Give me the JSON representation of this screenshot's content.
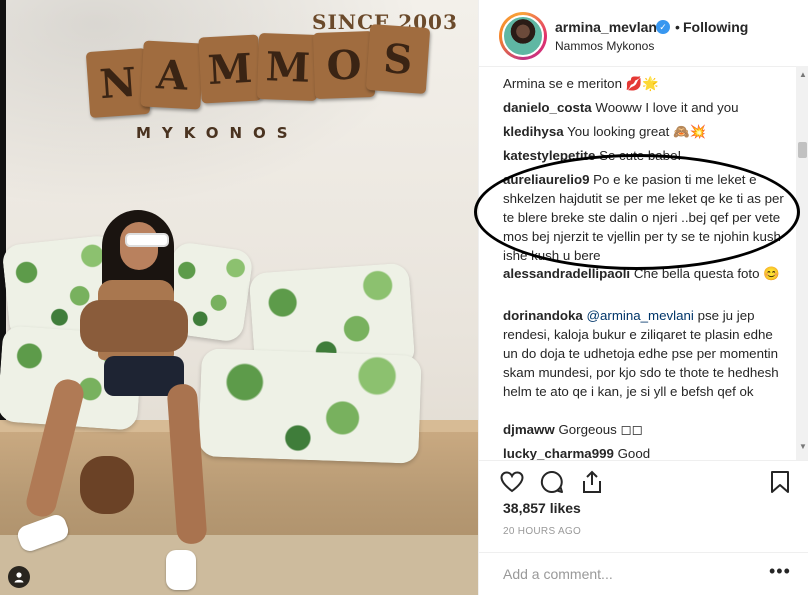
{
  "photo": {
    "sign_since": "SINCE 2003",
    "sign_letters": [
      "N",
      "A",
      "M",
      "M",
      "O",
      "S"
    ],
    "sign_sub": "MYKONOS",
    "tag_icon": "person-tag-icon"
  },
  "header": {
    "username": "armina_mevlani",
    "verified_icon": "verified-badge-icon",
    "separator": "•",
    "following_label": "Following",
    "location": "Nammos Mykonos"
  },
  "comments": [
    {
      "user": "",
      "text": "Armina se e meriton 💋🌟"
    },
    {
      "user": "danielo_costa",
      "text": "Wooww I love it and you"
    },
    {
      "user": "kledihysa",
      "text": "You looking great 🙈💥"
    },
    {
      "user": "katestylepetite",
      "text": "Se cute babe!"
    },
    {
      "user": "aureliaurelio9",
      "text": "Po e ke pasion ti me leket e shkelzen hajdutit se per me leket qe ke ti as per te blere breke ste dalin o njeri ..bej qef per vete mos bej njerzit te vjellin per ty se te njohin kush ishe kush u bere"
    },
    {
      "user": "alessandradellipaoli",
      "text": "Che bella questa foto 😊"
    },
    {
      "user": "dorinandoka",
      "mention": "@armina_mevlani",
      "text": "pse ju jep rendesi, kaloja bukur e ziliqaret te plasin edhe un do doja te udhetoja edhe pse per momentin skam mundesi, por kjo sdo te thote te hedhesh helm te ato qe i kan, je si yll e befsh qef ok"
    },
    {
      "user": "djmaww",
      "text": "Gorgeous ◻◻"
    },
    {
      "user": "lucky_charma999",
      "text": "Good"
    }
  ],
  "actions": {
    "like_icon": "heart-icon",
    "comment_icon": "comment-bubble-icon",
    "share_icon": "share-icon",
    "save_icon": "bookmark-icon"
  },
  "likes": "38,857 likes",
  "timestamp": "20 HOURS AGO",
  "add_comment_placeholder": "Add a comment...",
  "more_label": "•••"
}
